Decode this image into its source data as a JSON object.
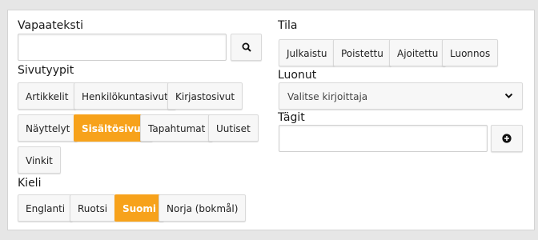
{
  "left": {
    "freetext_label": "Vapaateksti",
    "freetext_value": "",
    "pagetypes_label": "Sivutyypit",
    "pagetypes": [
      "Artikkelit",
      "Henkilökuntasivut",
      "Kirjastosivut",
      "Näyttelyt",
      "Sisältösivut",
      "Tapahtumat",
      "Uutiset",
      "Vinkit"
    ],
    "pagetype_selected": "Sisältösivut",
    "language_label": "Kieli",
    "languages": [
      "Englanti",
      "Ruotsi",
      "Suomi",
      "Norja (bokmål)"
    ],
    "language_selected": "Suomi"
  },
  "right": {
    "state_label": "Tila",
    "states": [
      "Julkaistu",
      "Poistettu",
      "Ajoitettu",
      "Luonnos"
    ],
    "author_label": "Luonut",
    "author_placeholder": "Valitse kirjoittaja",
    "tags_label": "Tägit",
    "tags_value": ""
  },
  "icons": {
    "search": "search-icon",
    "dropdown": "chevron-down-icon",
    "add": "plus-circle-icon"
  },
  "colors": {
    "accent": "#f7a21b",
    "background": "#e6e6e6",
    "panel": "#ffffff"
  }
}
